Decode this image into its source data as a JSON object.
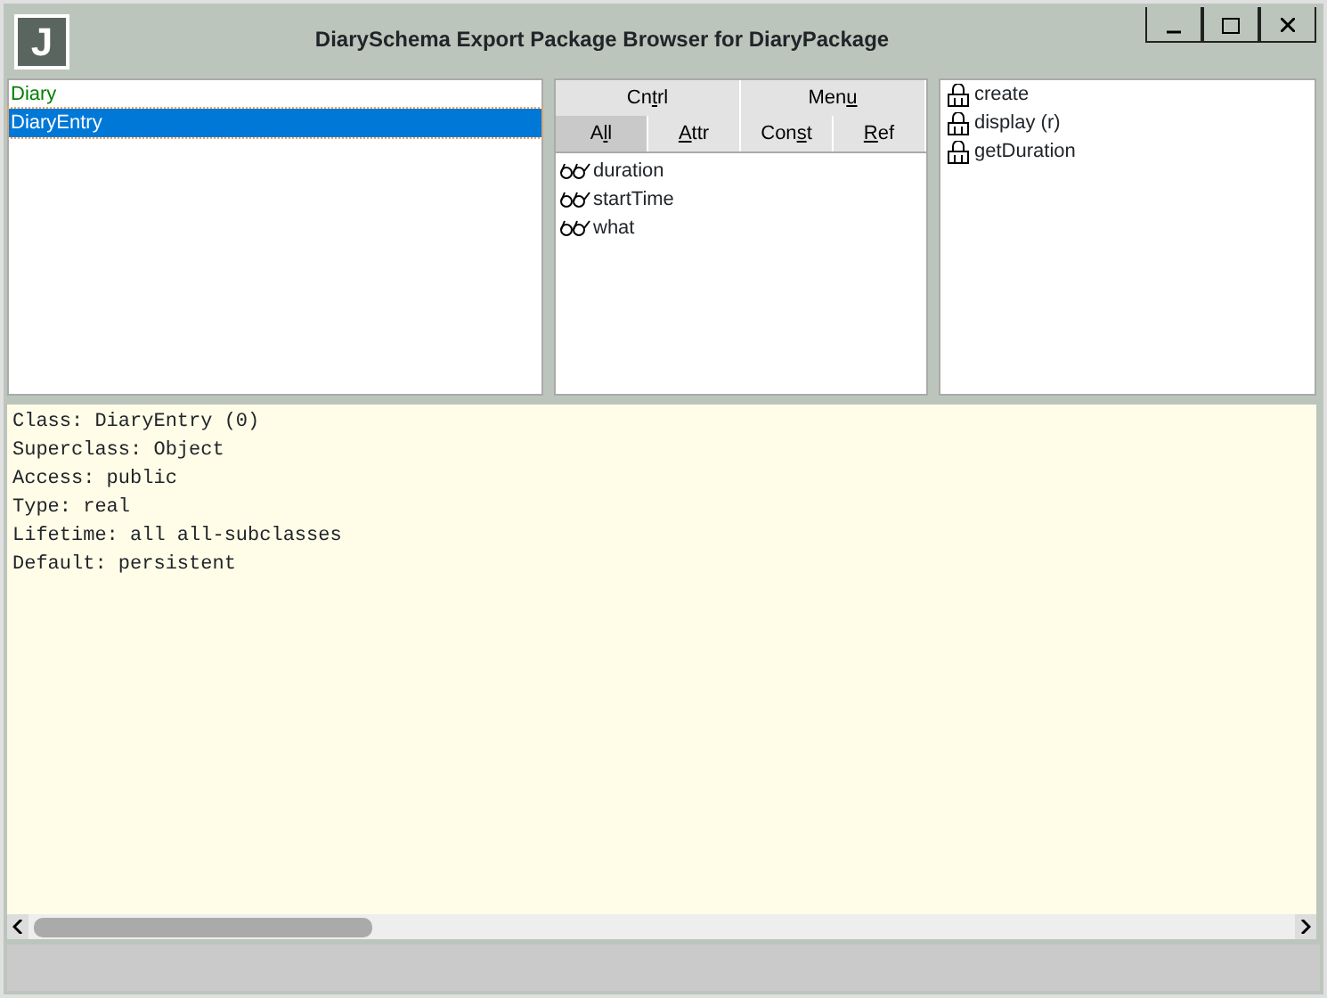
{
  "window": {
    "title": "DiarySchema Export Package Browser for DiaryPackage",
    "logo": "J",
    "controls": [
      {
        "kind": "minimize"
      },
      {
        "kind": "maximize"
      },
      {
        "kind": "close"
      }
    ]
  },
  "classes": [
    {
      "name": "Diary",
      "selected": false,
      "color": "#008000"
    },
    {
      "name": "DiaryEntry",
      "selected": true
    }
  ],
  "top_tabs": [
    {
      "label": {
        "before": "Cn",
        "key": "t",
        "after": "rl"
      },
      "selected": false
    },
    {
      "label": {
        "before": "Men",
        "key": "u"
      },
      "selected": false
    }
  ],
  "filter_tabs": [
    {
      "label": {
        "before": "A",
        "key": "l",
        "after": "l"
      },
      "selected": true
    },
    {
      "label": {
        "key": "A",
        "after": "ttr"
      },
      "selected": false
    },
    {
      "label": {
        "before": "Con",
        "key": "s",
        "after": "t"
      },
      "selected": false
    },
    {
      "label": {
        "key": "R",
        "after": "ef"
      },
      "selected": false
    }
  ],
  "properties": [
    {
      "name": "duration"
    },
    {
      "name": "startTime"
    },
    {
      "name": "what"
    }
  ],
  "methods": [
    {
      "name": "create"
    },
    {
      "name": "display (r)"
    },
    {
      "name": "getDuration"
    }
  ],
  "details": [
    "Class: DiaryEntry (0)",
    "Superclass: Object",
    "Access: public",
    "Type: real",
    "Lifetime: all all-subclasses",
    "Default: persistent"
  ]
}
